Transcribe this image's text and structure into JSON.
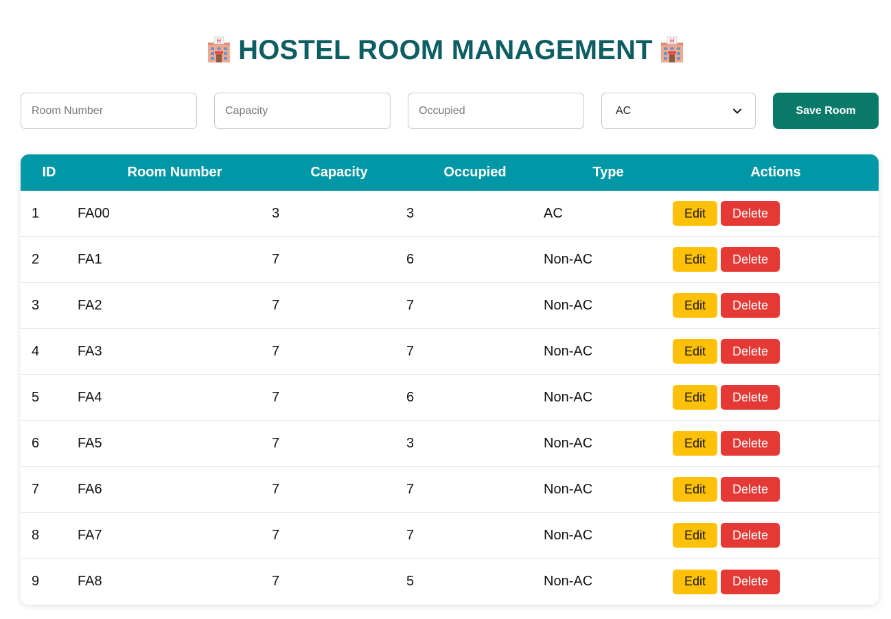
{
  "heading": {
    "icon": "hotel-icon",
    "title": "HOSTEL ROOM MANAGEMENT",
    "color": "#0d5e62"
  },
  "form": {
    "room_number_placeholder": "Room Number",
    "capacity_placeholder": "Capacity",
    "occupied_placeholder": "Occupied",
    "type_selected": "AC",
    "save_label": "Save Room",
    "save_color": "#097a69"
  },
  "table": {
    "header_color": "#0097a7",
    "columns": [
      "ID",
      "Room Number",
      "Capacity",
      "Occupied",
      "Type",
      "Actions"
    ],
    "edit_label": "Edit",
    "delete_label": "Delete",
    "rows": [
      {
        "id": "1",
        "room": "FA00",
        "capacity": "3",
        "occupied": "3",
        "type": "AC"
      },
      {
        "id": "2",
        "room": "FA1",
        "capacity": "7",
        "occupied": "6",
        "type": "Non-AC"
      },
      {
        "id": "3",
        "room": "FA2",
        "capacity": "7",
        "occupied": "7",
        "type": "Non-AC"
      },
      {
        "id": "4",
        "room": "FA3",
        "capacity": "7",
        "occupied": "7",
        "type": "Non-AC"
      },
      {
        "id": "5",
        "room": "FA4",
        "capacity": "7",
        "occupied": "6",
        "type": "Non-AC"
      },
      {
        "id": "6",
        "room": "FA5",
        "capacity": "7",
        "occupied": "3",
        "type": "Non-AC"
      },
      {
        "id": "7",
        "room": "FA6",
        "capacity": "7",
        "occupied": "7",
        "type": "Non-AC"
      },
      {
        "id": "8",
        "room": "FA7",
        "capacity": "7",
        "occupied": "7",
        "type": "Non-AC"
      },
      {
        "id": "9",
        "room": "FA8",
        "capacity": "7",
        "occupied": "5",
        "type": "Non-AC"
      }
    ]
  }
}
